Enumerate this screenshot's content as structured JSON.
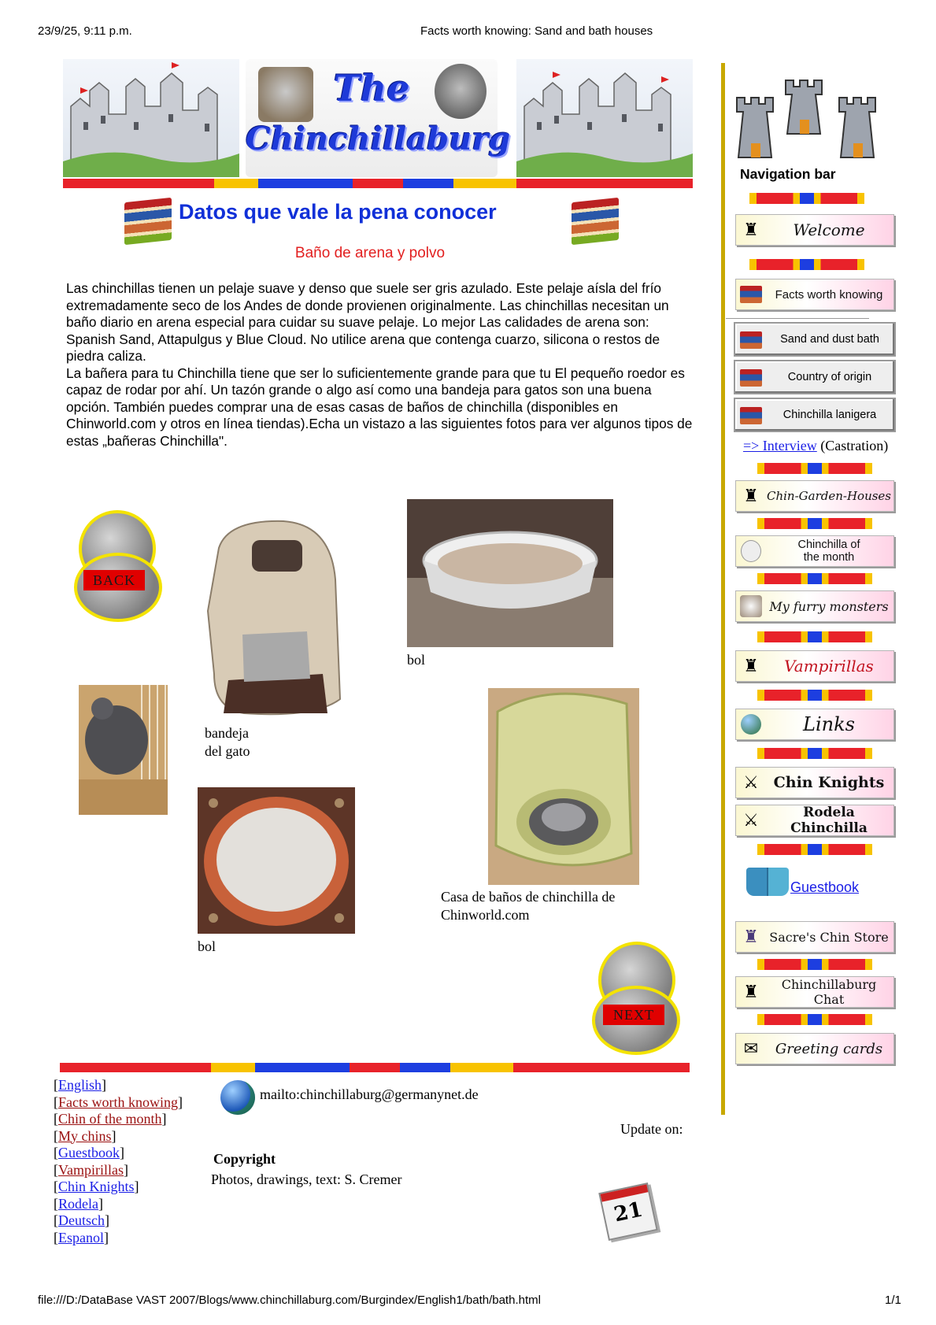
{
  "print_header": {
    "datetime": "23/9/25, 9:11 p.m.",
    "title": "Facts worth knowing: Sand and bath houses"
  },
  "print_footer": {
    "url": "file:///D:/DataBase VAST 2007/Blogs/www.chinchillaburg.com/Burgindex/English1/bath/bath.html",
    "page": "1/1"
  },
  "banner": {
    "logo_line1": "The",
    "logo_line2": "Chinchillaburg"
  },
  "main": {
    "title": "Datos que vale la pena conocer",
    "subtitle": "Baño de arena y polvo",
    "paragraph1": "Las chinchillas tienen un pelaje suave y denso que suele ser gris azulado. Este pelaje aísla del frío extremadamente seco de los Andes de donde provienen originalmente. Las chinchillas necesitan un baño diario en arena especial para cuidar su suave pelaje. Lo mejor Las calidades de arena son: Spanish Sand, Attapulgus y Blue Cloud. No utilice arena que contenga cuarzo, silicona o restos de piedra caliza.",
    "paragraph2": "La bañera para tu Chinchilla tiene que ser lo suficientemente grande para que tu El pequeño roedor es capaz de rodar por ahí. Un tazón grande o algo así como una bandeja para gatos son una buena opción. También puedes comprar una de esas casas de baños de chinchilla (disponibles en Chinworld.com y otros en línea tiendas).Echa un vistazo a las siguientes fotos para ver algunos tipos de estas „bañeras Chinchilla\"."
  },
  "photos": {
    "caption_bowl_top": "bol",
    "caption_cat_tray_1": "bandeja",
    "caption_cat_tray_2": "del gato",
    "caption_bowl_bottom": "bol",
    "caption_house_1": "Casa de baños de chinchilla de",
    "caption_house_2": "Chinworld.com"
  },
  "mascots": {
    "back_label": "BACK",
    "next_label": "NEXT"
  },
  "sidebar": {
    "heading": "Navigation bar",
    "welcome": "Welcome",
    "facts": "Facts worth knowing",
    "sand": "Sand and dust bath",
    "country": "Country of origin",
    "lanigera": "Chinchilla lanigera",
    "interview_link": "=> Interview",
    "interview_note": "(Castration)",
    "garden": "Chin-Garden-Houses",
    "cotm_1": "Chinchilla of",
    "cotm_2": "the month",
    "furry": "My furry monsters",
    "vampirillas": "Vampirillas",
    "links": "Links",
    "knights": "Chin Knights",
    "rodela": "Rodela Chinchilla",
    "guestbook": "Guestbook",
    "store": "Sacre's Chin Store",
    "chat": "Chinchillaburg Chat",
    "cards": "Greeting cards"
  },
  "footer": {
    "links": [
      "English",
      "Facts worth knowing",
      "Chin of the month",
      "My chins",
      "Guestbook",
      "Vampirillas",
      "Chin Knights",
      "Rodela",
      "Deutsch",
      "Espanol"
    ],
    "mailto": "mailto:chinchillaburg@germanynet.de",
    "update_on": "Update on:",
    "copyright_heading": "Copyright",
    "copyright_text": "Photos, drawings, text: S. Cremer",
    "calendar_day": "21"
  },
  "colors": {
    "title_blue": "#1030d8",
    "subtitle_red": "#e21f1f",
    "link_blue": "#1a1ee6",
    "visited_red": "#9a1010",
    "sidebar_rule": "#c8a800"
  }
}
